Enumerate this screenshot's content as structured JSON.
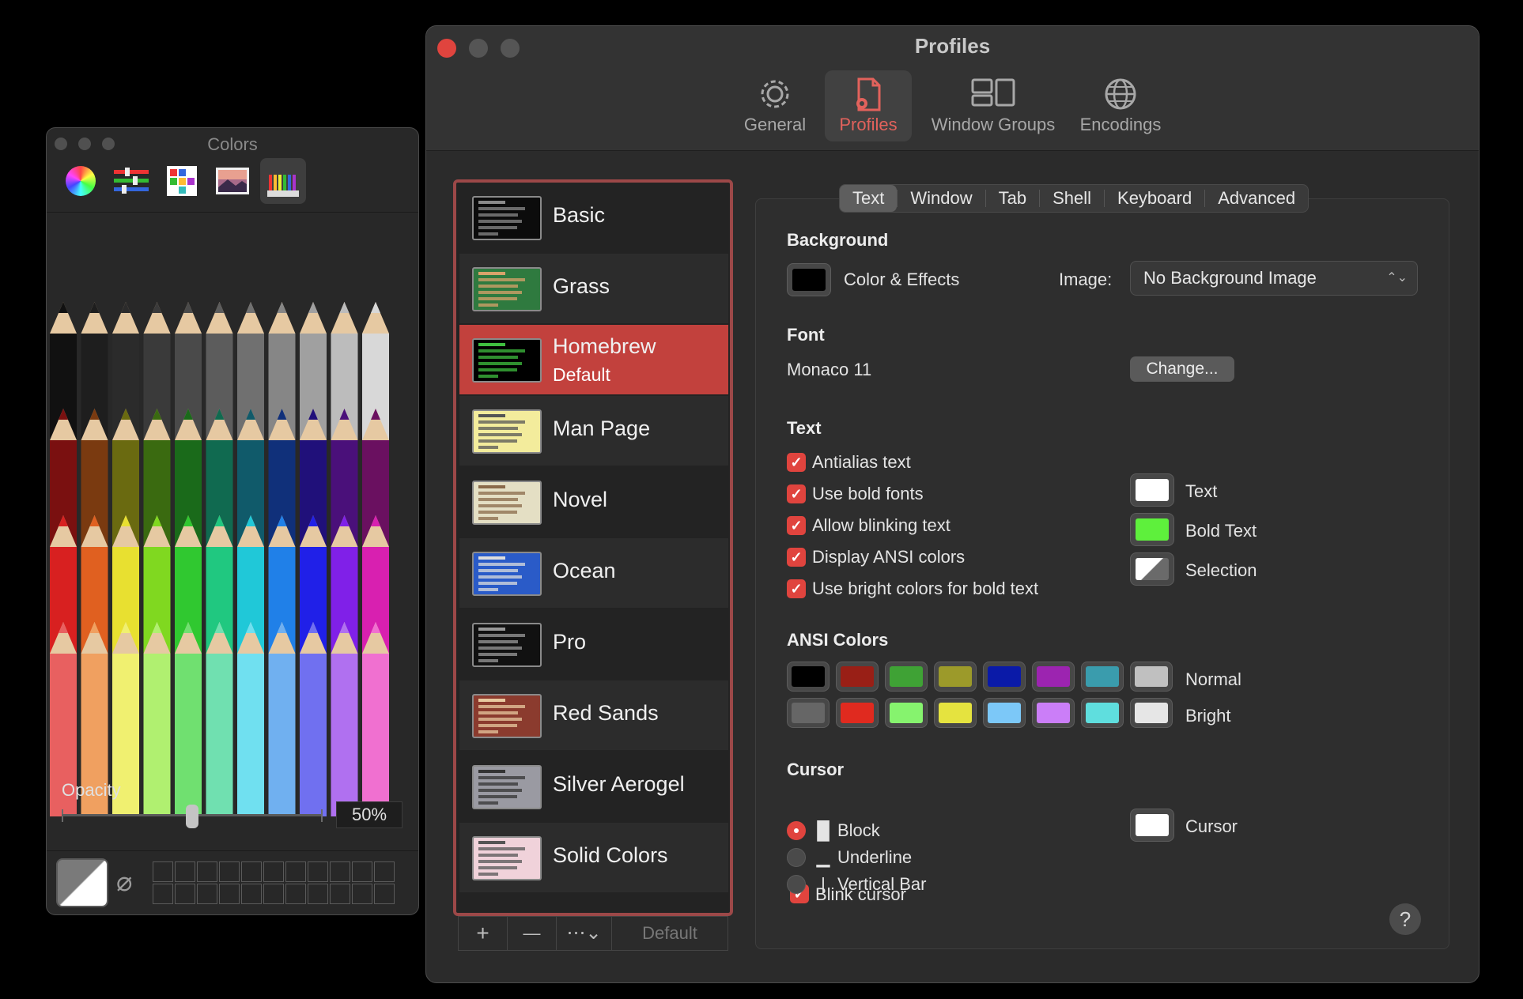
{
  "colors_panel": {
    "title": "Colors",
    "modes": [
      "color-wheel",
      "sliders",
      "palettes",
      "image-palettes",
      "pencils"
    ],
    "opacity_label": "Opacity",
    "opacity_value": "50%",
    "opacity_fraction": 0.5
  },
  "window": {
    "title": "Profiles",
    "toolbar": [
      {
        "label": "General",
        "icon": "gear-icon"
      },
      {
        "label": "Profiles",
        "icon": "profile-doc-icon"
      },
      {
        "label": "Window Groups",
        "icon": "window-groups-icon"
      },
      {
        "label": "Encodings",
        "icon": "globe-icon"
      }
    ]
  },
  "profiles": [
    {
      "name": "Basic",
      "thumb_bg": "#0c0c0c",
      "thumb_fg": "#8a8a8a"
    },
    {
      "name": "Grass",
      "thumb_bg": "#2f7a3f",
      "thumb_fg": "#d9a36b"
    },
    {
      "name": "Homebrew",
      "sub": "Default",
      "thumb_bg": "#000000",
      "thumb_fg": "#3fbf3f"
    },
    {
      "name": "Man Page",
      "thumb_bg": "#f3ec9c",
      "thumb_fg": "#555555"
    },
    {
      "name": "Novel",
      "thumb_bg": "#e4dfc4",
      "thumb_fg": "#8a6a4a"
    },
    {
      "name": "Ocean",
      "thumb_bg": "#2a5bc8",
      "thumb_fg": "#dddddd"
    },
    {
      "name": "Pro",
      "thumb_bg": "#111111",
      "thumb_fg": "#999999"
    },
    {
      "name": "Red Sands",
      "thumb_bg": "#8b3b2e",
      "thumb_fg": "#e8c9a0"
    },
    {
      "name": "Silver Aerogel",
      "thumb_bg": "#9a9aa2",
      "thumb_fg": "#333333"
    },
    {
      "name": "Solid Colors",
      "thumb_bg": "#f0d2da",
      "thumb_fg": "#555555"
    }
  ],
  "list_bar": {
    "add": "+",
    "remove": "—",
    "more": "⋯⌄",
    "default": "Default"
  },
  "tabs": [
    "Text",
    "Window",
    "Tab",
    "Shell",
    "Keyboard",
    "Advanced"
  ],
  "background": {
    "heading": "Background",
    "color_label": "Color & Effects",
    "color": "#000000",
    "image_label": "Image:",
    "image_value": "No Background Image"
  },
  "font": {
    "heading": "Font",
    "value": "Monaco 11",
    "change_button": "Change..."
  },
  "text": {
    "heading": "Text",
    "options": [
      {
        "label": "Antialias text",
        "checked": true
      },
      {
        "label": "Use bold fonts",
        "checked": true
      },
      {
        "label": "Allow blinking text",
        "checked": true
      },
      {
        "label": "Display ANSI colors",
        "checked": true
      },
      {
        "label": "Use bright colors for bold text",
        "checked": true
      }
    ],
    "wells": [
      {
        "label": "Text",
        "color": "#ffffff"
      },
      {
        "label": "Bold Text",
        "color": "#5ef03c"
      },
      {
        "label": "Selection",
        "color": "selection"
      }
    ]
  },
  "ansi": {
    "heading": "ANSI Colors",
    "normal_label": "Normal",
    "bright_label": "Bright",
    "normal": [
      "#000000",
      "#991f16",
      "#3fa235",
      "#9c9a2a",
      "#0a1aa8",
      "#9c24b0",
      "#3a9cad",
      "#c0c0c0"
    ],
    "bright": [
      "#666666",
      "#e02a1f",
      "#86f36e",
      "#e5e33f",
      "#7cc8f8",
      "#cb7ef8",
      "#5fdede",
      "#e6e6e6"
    ]
  },
  "cursor": {
    "heading": "Cursor",
    "options": [
      {
        "glyph": "█",
        "label": "Block",
        "selected": true
      },
      {
        "glyph": "▁",
        "label": "Underline",
        "selected": false
      },
      {
        "glyph": "|",
        "label": "Vertical Bar",
        "selected": false
      }
    ],
    "blink_label": "Blink cursor",
    "blink_checked": true,
    "well_label": "Cursor",
    "well_color": "#ffffff"
  },
  "help": "?"
}
